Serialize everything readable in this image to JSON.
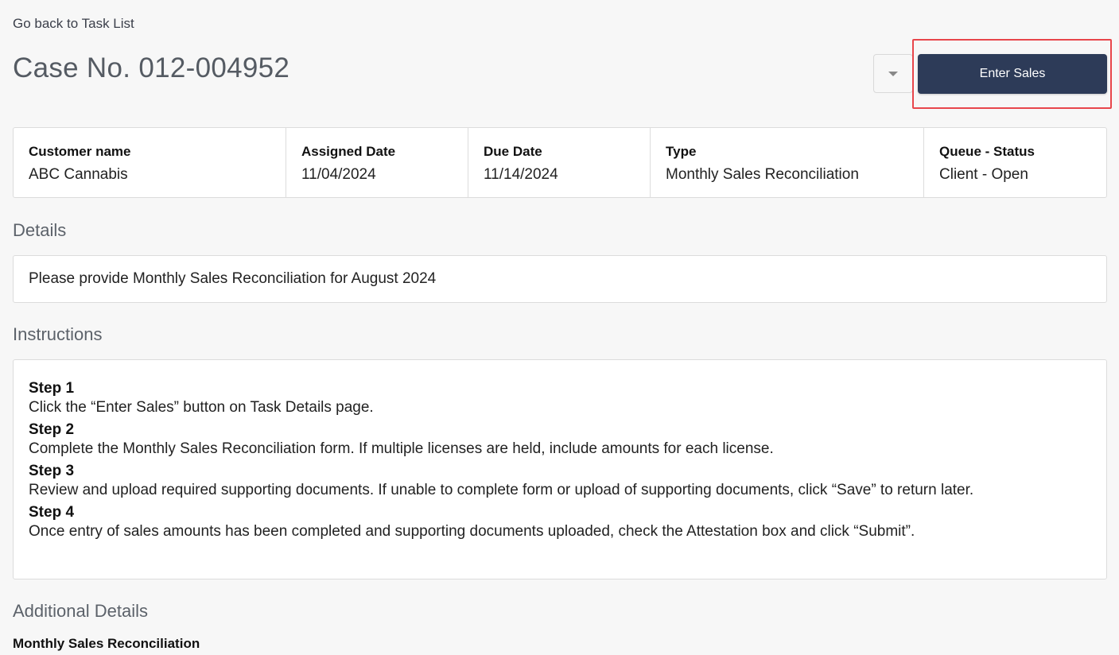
{
  "nav": {
    "back_link": "Go back to Task List"
  },
  "header": {
    "case_title": "Case No. 012-004952",
    "enter_sales_label": "Enter Sales"
  },
  "summary": [
    {
      "label": "Customer name",
      "value": "ABC Cannabis"
    },
    {
      "label": "Assigned Date",
      "value": "11/04/2024"
    },
    {
      "label": "Due Date",
      "value": "11/14/2024"
    },
    {
      "label": "Type",
      "value": "Monthly Sales Reconciliation"
    },
    {
      "label": "Queue - Status",
      "value": "Client - Open"
    }
  ],
  "details": {
    "title": "Details",
    "text": "Please provide Monthly Sales Reconciliation for August 2024"
  },
  "instructions": {
    "title": "Instructions",
    "steps": [
      {
        "title": "Step 1",
        "text": "Click the “Enter Sales” button on Task Details page."
      },
      {
        "title": "Step 2",
        "text": "Complete the Monthly Sales Reconciliation form. If multiple licenses are held, include amounts for each license."
      },
      {
        "title": "Step 3",
        "text": "Review and upload required supporting documents. If unable to complete form or upload of supporting documents, click “Save” to return later."
      },
      {
        "title": "Step 4",
        "text": "Once entry of sales amounts has been completed and supporting documents uploaded, check the Attestation box and click “Submit”."
      }
    ]
  },
  "additional": {
    "title": "Additional Details",
    "subtitle": "Monthly Sales Reconciliation"
  },
  "colors": {
    "primary_button": "#2d3b58",
    "highlight": "#e8464b",
    "background": "#f7f7f7"
  },
  "icons": {
    "dropdown": "chevron-down-icon"
  }
}
